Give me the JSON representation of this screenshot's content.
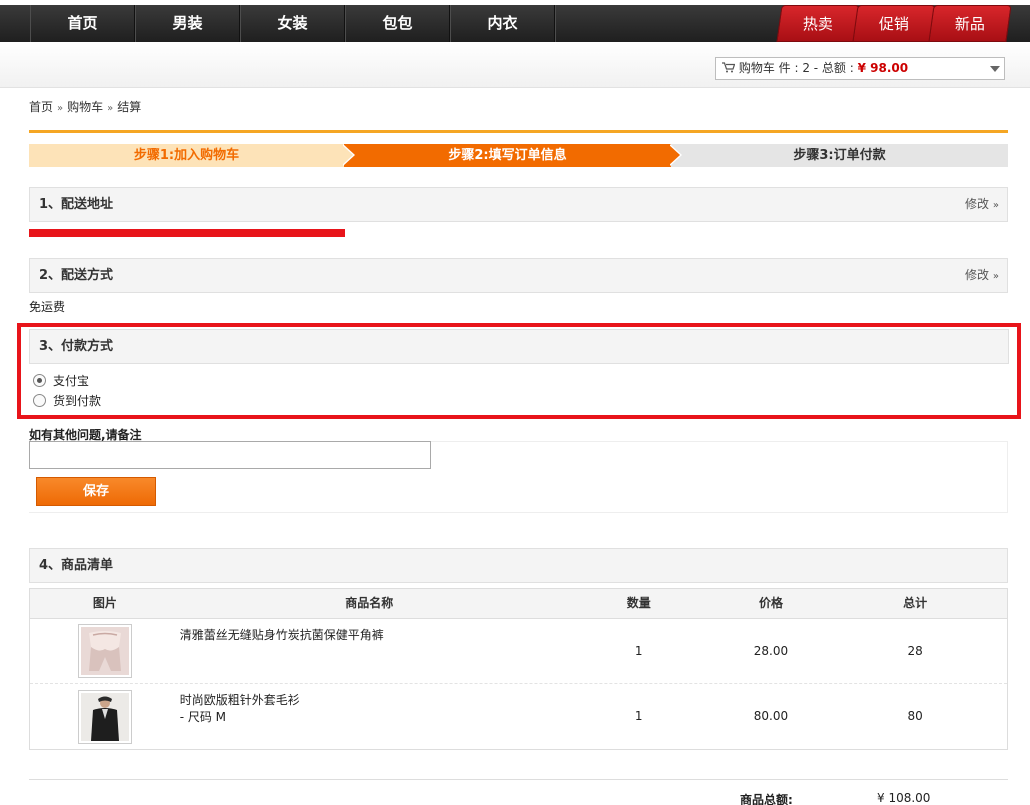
{
  "nav": {
    "items": [
      "首页",
      "男装",
      "女装",
      "包包",
      "内衣"
    ],
    "promos": [
      "热卖",
      "促销",
      "新品"
    ]
  },
  "cart": {
    "label": "购物车 件 : 2 - 总额 : ",
    "total": "¥ 98.00"
  },
  "breadcrumb": [
    "首页",
    "购物车",
    "结算"
  ],
  "steps": [
    "步骤1:加入购物车",
    "步骤2:填写订单信息",
    "步骤3:订单付款"
  ],
  "sections": {
    "address": {
      "title": "1、配送地址",
      "edit": "修改"
    },
    "shipping": {
      "title": "2、配送方式",
      "edit": "修改",
      "note": "免运费"
    },
    "payment": {
      "title": "3、付款方式",
      "options": [
        "支付宝",
        "货到付款"
      ],
      "selected": 0
    },
    "remark": {
      "label": "如有其他问题,请备注",
      "value": "",
      "save": "保存"
    },
    "products": {
      "title": "4、商品清单"
    }
  },
  "table": {
    "headers": [
      "图片",
      "商品名称",
      "数量",
      "价格",
      "总计"
    ],
    "rows": [
      {
        "name": "清雅蕾丝无缝贴身竹炭抗菌保健平角裤",
        "option": "",
        "qty": "1",
        "price": "28.00",
        "total": "28"
      },
      {
        "name": "时尚欧版粗针外套毛衫",
        "option": "- 尺码 M",
        "qty": "1",
        "price": "80.00",
        "total": "80"
      }
    ]
  },
  "summary": {
    "label": "商品总额:",
    "value": "¥ 108.00"
  },
  "colors": {
    "accent": "#f26b00",
    "promo": "#c8171c",
    "highlight": "#e8141a"
  }
}
